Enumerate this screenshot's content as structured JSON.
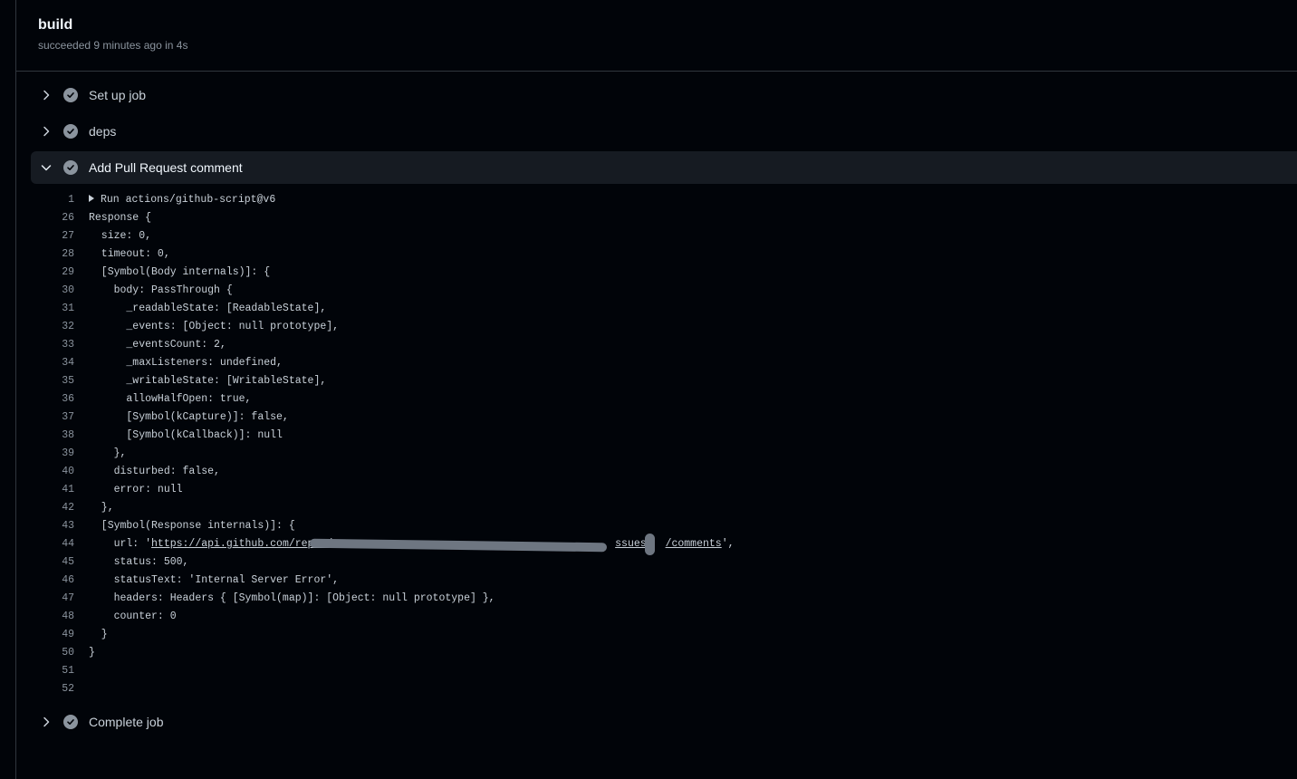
{
  "job": {
    "title": "build",
    "status": "succeeded",
    "time": "9 minutes ago",
    "duration": "in 4s"
  },
  "steps_before": [
    {
      "label": "Set up job",
      "state": "collapsed",
      "status": "success"
    },
    {
      "label": "deps",
      "state": "collapsed",
      "status": "success"
    },
    {
      "label": "Add Pull Request comment",
      "state": "expanded",
      "status": "success"
    }
  ],
  "log": {
    "group_line": {
      "number": "1",
      "text": "Run actions/github-script@v6"
    },
    "lines": [
      {
        "number": "26",
        "text": "Response {"
      },
      {
        "number": "27",
        "text": "  size: 0,"
      },
      {
        "number": "28",
        "text": "  timeout: 0,"
      },
      {
        "number": "29",
        "text": "  [Symbol(Body internals)]: {"
      },
      {
        "number": "30",
        "text": "    body: PassThrough {"
      },
      {
        "number": "31",
        "text": "      _readableState: [ReadableState],"
      },
      {
        "number": "32",
        "text": "      _events: [Object: null prototype],"
      },
      {
        "number": "33",
        "text": "      _eventsCount: 2,"
      },
      {
        "number": "34",
        "text": "      _maxListeners: undefined,"
      },
      {
        "number": "35",
        "text": "      _writableState: [WritableState],"
      },
      {
        "number": "36",
        "text": "      allowHalfOpen: true,"
      },
      {
        "number": "37",
        "text": "      [Symbol(kCapture)]: false,"
      },
      {
        "number": "38",
        "text": "      [Symbol(kCallback)]: null"
      },
      {
        "number": "39",
        "text": "    },"
      },
      {
        "number": "40",
        "text": "    disturbed: false,"
      },
      {
        "number": "41",
        "text": "    error: null"
      },
      {
        "number": "42",
        "text": "  },"
      },
      {
        "number": "43",
        "text": "  [Symbol(Response internals)]: {"
      }
    ],
    "url_line": {
      "number": "44",
      "prefix": "    url: '",
      "url_start": "https://api.github.com/repos/",
      "url_end": "ssues/",
      "url_tail": "/comments",
      "suffix": "',"
    },
    "lines_after": [
      {
        "number": "45",
        "text": "    status: 500,"
      },
      {
        "number": "46",
        "text": "    statusText: 'Internal Server Error',"
      },
      {
        "number": "47",
        "text": "    headers: Headers { [Symbol(map)]: [Object: null prototype] },"
      },
      {
        "number": "48",
        "text": "    counter: 0"
      },
      {
        "number": "49",
        "text": "  }"
      },
      {
        "number": "50",
        "text": "}"
      },
      {
        "number": "51",
        "text": ""
      },
      {
        "number": "52",
        "text": ""
      }
    ]
  },
  "steps_after": [
    {
      "label": "Complete job",
      "state": "collapsed",
      "status": "success"
    }
  ],
  "colors": {
    "background": "#010409",
    "expanded_row": "#161b22",
    "border": "#30363d",
    "check": "#8b949e"
  }
}
